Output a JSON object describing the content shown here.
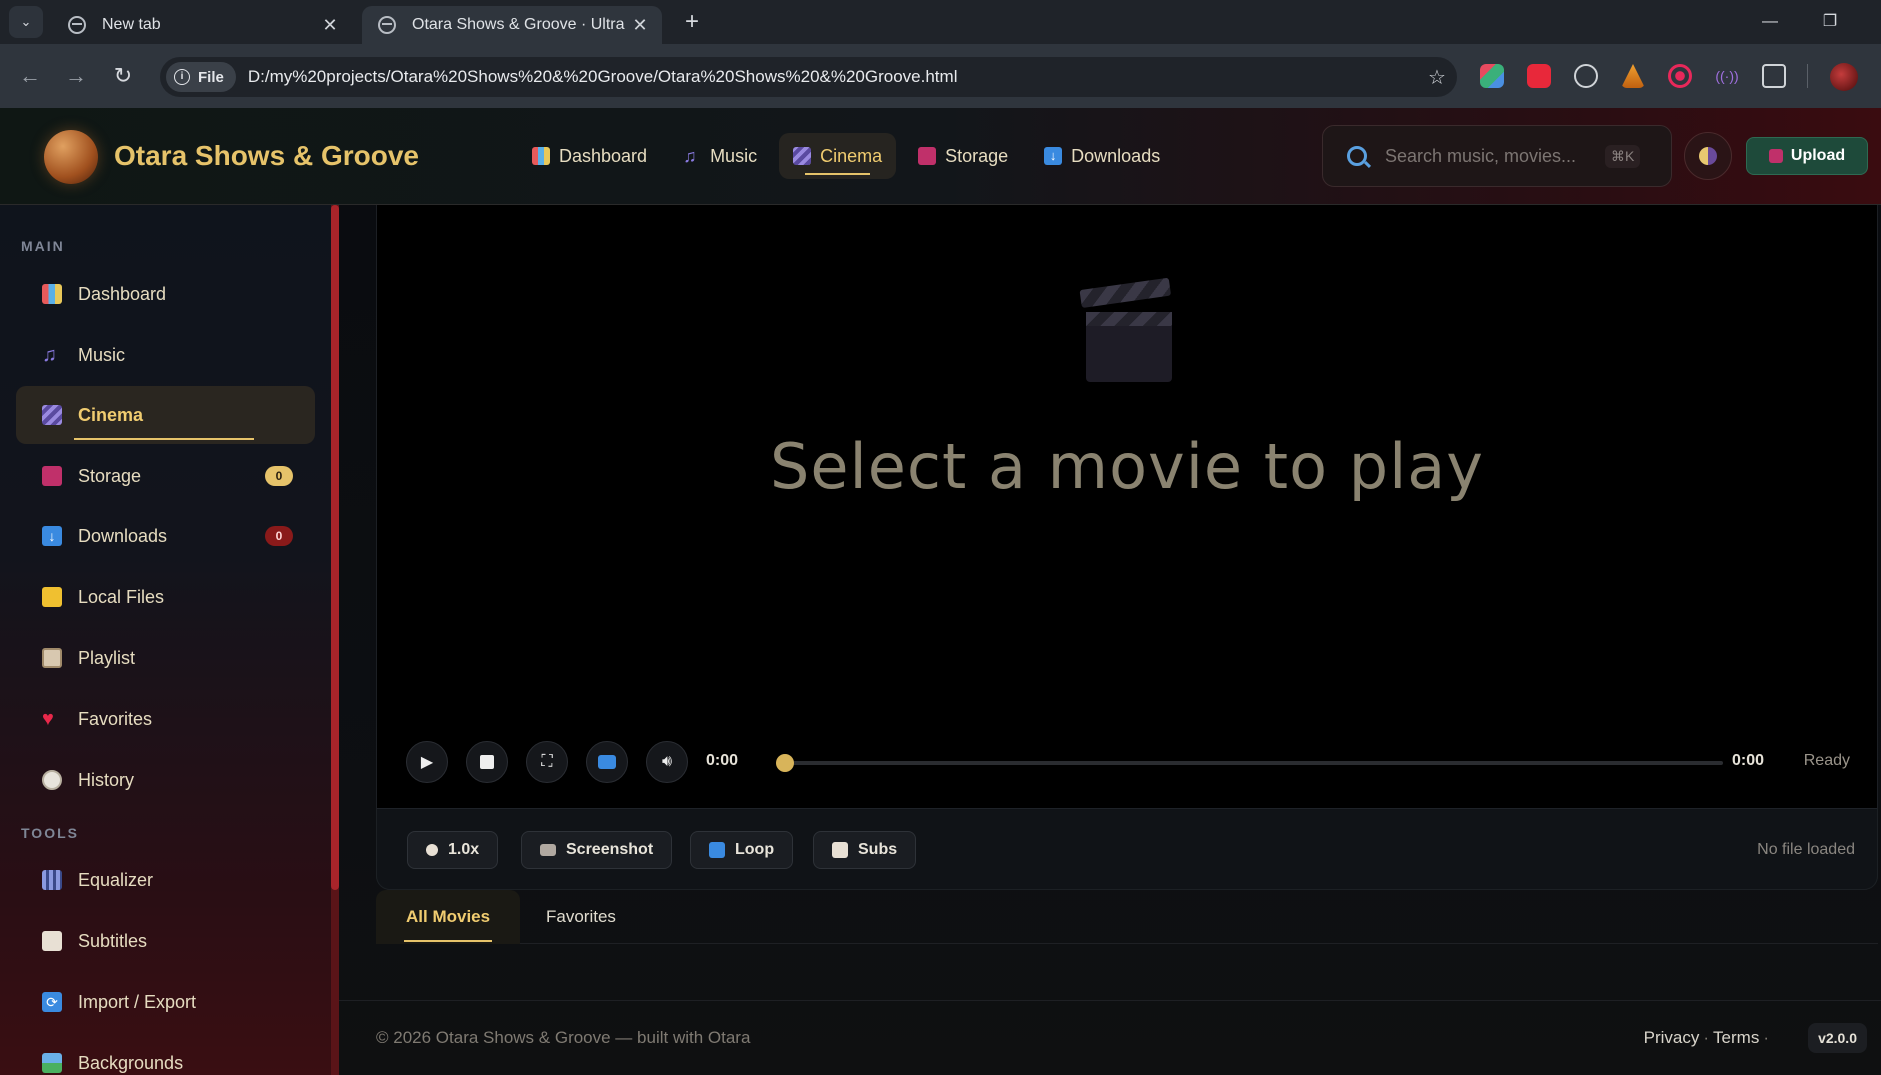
{
  "browser": {
    "tabs": [
      {
        "title": "New tab",
        "active": false
      },
      {
        "title": "Otara Shows & Groove · Ultra P",
        "active": true
      }
    ],
    "url_chip": "File",
    "url": "D:/my%20projects/Otara%20Shows%20&%20Groove/Otara%20Shows%20&%20Groove.html"
  },
  "header": {
    "brand": "Otara Shows & Groove",
    "nav": [
      {
        "label": "Dashboard",
        "icon": "chart-icon"
      },
      {
        "label": "Music",
        "icon": "music-note-icon"
      },
      {
        "label": "Cinema",
        "icon": "clapper-icon",
        "active": true
      },
      {
        "label": "Storage",
        "icon": "floppy-disk-icon"
      },
      {
        "label": "Downloads",
        "icon": "download-arrow-icon"
      }
    ],
    "search_placeholder": "Search music, movies...",
    "search_shortcut": "⌘K",
    "upload_label": "Upload"
  },
  "sidebar": {
    "main_label": "MAIN",
    "tools_label": "TOOLS",
    "main_items": [
      {
        "label": "Dashboard",
        "icon": "chart-icon"
      },
      {
        "label": "Music",
        "icon": "music-note-icon"
      },
      {
        "label": "Cinema",
        "icon": "clapper-icon",
        "active": true
      },
      {
        "label": "Storage",
        "icon": "floppy-disk-icon",
        "badge": "0"
      },
      {
        "label": "Downloads",
        "icon": "download-arrow-icon",
        "badge": "0"
      },
      {
        "label": "Local Files",
        "icon": "folder-icon"
      },
      {
        "label": "Playlist",
        "icon": "clipboard-icon"
      },
      {
        "label": "Favorites",
        "icon": "heart-icon"
      },
      {
        "label": "History",
        "icon": "clock-icon"
      }
    ],
    "tools_items": [
      {
        "label": "Equalizer",
        "icon": "equalizer-icon"
      },
      {
        "label": "Subtitles",
        "icon": "document-icon"
      },
      {
        "label": "Import / Export",
        "icon": "sync-icon"
      },
      {
        "label": "Backgrounds",
        "icon": "image-icon"
      }
    ]
  },
  "player": {
    "empty_message": "Select a movie to play",
    "current_time": "0:00",
    "total_time": "0:00",
    "status": "Ready",
    "progress": 0,
    "tools": {
      "speed": "1.0x",
      "screenshot": "Screenshot",
      "loop": "Loop",
      "subs": "Subs"
    },
    "file_status": "No file loaded"
  },
  "tabs": [
    {
      "label": "All Movies",
      "active": true
    },
    {
      "label": "Favorites",
      "active": false
    }
  ],
  "footer": {
    "copyright": "© 2026 Otara Shows & Groove — built with Otara",
    "privacy": "Privacy",
    "terms": "Terms",
    "dot": "·",
    "version": "v2.0.0"
  },
  "colors": {
    "accent_gold": "#e6c36a",
    "upload_green": "#1e4a3a",
    "badge_red": "#8a1a1a"
  }
}
